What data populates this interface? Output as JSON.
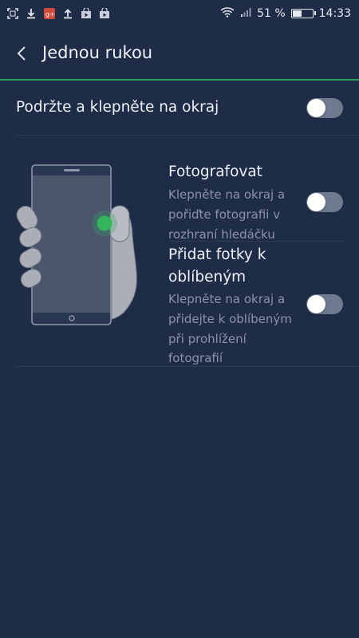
{
  "status_bar": {
    "battery_percent": "51 %",
    "battery_level": 0.51,
    "time": "14:33",
    "left_icons": [
      "screenshot-icon",
      "download-icon",
      "google-plus-icon",
      "upload-icon",
      "play-store-icon",
      "play-store-icon"
    ]
  },
  "header": {
    "title": "Jednou rukou"
  },
  "main_setting": {
    "label": "Podržte a klepněte na okraj",
    "enabled": false
  },
  "sub_settings": [
    {
      "title": "Fotografovat",
      "desc_lines": [
        "Klepněte na okraj a",
        "pořiďte fotografii v",
        "rozhraní hledáčku"
      ],
      "enabled": false
    },
    {
      "title_lines": [
        "Přidat fotky k",
        "oblíbeným"
      ],
      "desc_lines": [
        "Klepněte na okraj a",
        "přidejte k oblíbeným",
        "při prohlížení",
        "fotografií"
      ],
      "enabled": false
    }
  ],
  "colors": {
    "background": "#1f2c47",
    "accent": "#2e9a5e",
    "toggle_off": "#6e7a8e",
    "secondary_text": "#8b94a6"
  }
}
